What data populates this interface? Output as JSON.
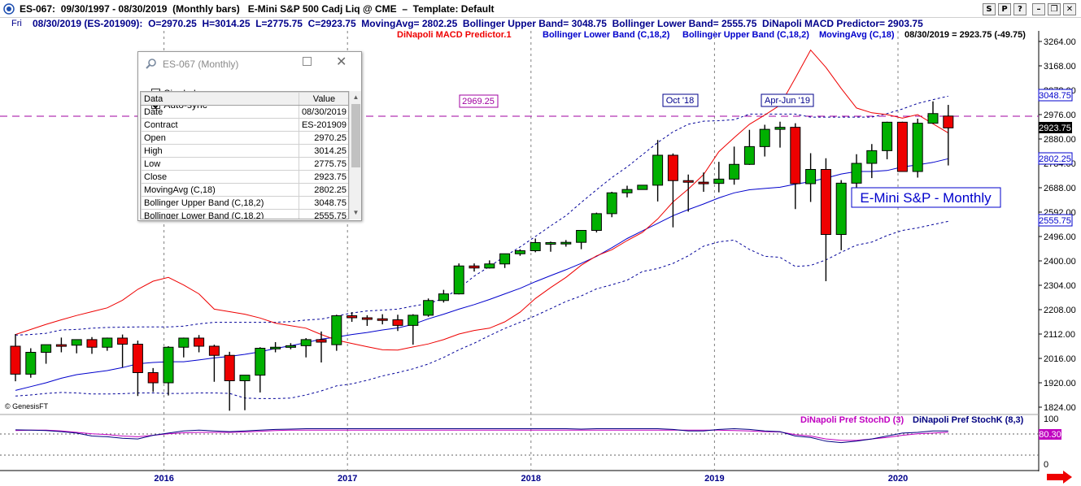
{
  "window": {
    "title": "ES-067:  09/30/1997 - 08/30/2019  (Monthly bars)   E-Mini S&P 500 Cadj Liq @ CME  –  Template: Default",
    "buttons": [
      "S",
      "P",
      "?",
      "–",
      "❐",
      "✕"
    ]
  },
  "infobar": {
    "day": "Fri",
    "data": "08/30/2019 (ES-201909):  O=2970.25  H=3014.25  L=2775.75  C=2923.75  MovingAvg= 2802.25  Bollinger Upper Band= 3048.75  Bollinger Lower Band= 2555.75  DiNapoli MACD Predictor= 2903.75"
  },
  "legend": {
    "macd": "DiNapoli MACD Predictor.1",
    "lower": "Bollinger Lower Band (C,18,2)",
    "upper": "Bollinger Upper Band (C,18,2)",
    "ma": "MovingAvg (C,18)",
    "last": "08/30/2019 = 2923.75 (-49.75)"
  },
  "colors": {
    "up_candle": "#00b000",
    "down_candle": "#ee0000",
    "macd": "#ee0000",
    "ma": "#0000cc",
    "bands": "#000099",
    "stoch_d": "#c000c0",
    "stoch_k": "#000080",
    "hline": "#a000a0"
  },
  "popup": {
    "title": "ES-067 (Monthly)",
    "single_bar": "Single bar",
    "auto_sync": "Auto-sync",
    "header": [
      "Data",
      "Value"
    ],
    "rows": [
      [
        "Date",
        "08/30/2019"
      ],
      [
        "Contract",
        "ES-201909"
      ],
      [
        "Open",
        "2970.25"
      ],
      [
        "High",
        "3014.25"
      ],
      [
        "Low",
        "2775.75"
      ],
      [
        "Close",
        "2923.75"
      ],
      [
        "MovingAvg (C,18)",
        "2802.25"
      ],
      [
        "Bollinger Upper Band (C,18,2)",
        "3048.75"
      ],
      [
        "Bollinger Lower Band (C,18,2)",
        "2555.75"
      ]
    ]
  },
  "annotations": {
    "hline_label": "2969.25",
    "oct18": "Oct '18",
    "aprjun19": "Apr-Jun '19",
    "big_label": "E-Mini S&P - Monthly",
    "watermark": "© GenesisFT"
  },
  "price_badges": {
    "upper": "3048.75",
    "close": "2923.75",
    "ma": "2802.25",
    "lower": "2555.75"
  },
  "stoch": {
    "labels": [
      "DiNapoli Pref StochD (3)",
      "DiNapoli Pref StochK (8,3)"
    ],
    "value_badge": "80.30",
    "ticks": [
      "100",
      "0"
    ]
  },
  "chart_data": {
    "type": "candlestick",
    "title": "E-Mini S&P - Monthly",
    "x_tick_labels": [
      "2016",
      "2017",
      "2018",
      "2019",
      "2020"
    ],
    "y_tick_labels": [
      "3264.00",
      "3168.00",
      "3072.00",
      "2976.00",
      "2880.00",
      "2784.00",
      "2688.00",
      "2592.00",
      "2496.00",
      "2400.00",
      "2304.00",
      "2208.00",
      "2112.00",
      "2016.00",
      "1920.00",
      "1824.00"
    ],
    "ylim": [
      1795,
      3300
    ],
    "grid": false,
    "series": [
      {
        "name": "Candles (O,H,L,C)",
        "start": "2015-03",
        "values": [
          [
            2064,
            2112,
            1926,
            1954
          ],
          [
            1954,
            2056,
            1940,
            2040
          ],
          [
            2040,
            2068,
            1995,
            2070
          ],
          [
            2070,
            2098,
            2040,
            2066
          ],
          [
            2068,
            2084,
            2036,
            2090
          ],
          [
            2090,
            2100,
            2034,
            2060
          ],
          [
            2060,
            2098,
            2046,
            2096
          ],
          [
            2096,
            2110,
            1981,
            2072
          ],
          [
            2072,
            2086,
            1868,
            1960
          ],
          [
            1960,
            1978,
            1884,
            1920
          ],
          [
            1920,
            2064,
            1870,
            2060
          ],
          [
            2060,
            2098,
            2020,
            2096
          ],
          [
            2096,
            2108,
            2040,
            2064
          ],
          [
            2064,
            2070,
            1924,
            2028
          ],
          [
            2028,
            2042,
            1810,
            1928
          ],
          [
            1928,
            1942,
            1812,
            1950
          ],
          [
            1950,
            2060,
            1882,
            2056
          ],
          [
            2056,
            2080,
            2040,
            2060
          ],
          [
            2060,
            2076,
            2052,
            2066
          ],
          [
            2066,
            2096,
            2020,
            2090
          ],
          [
            2090,
            2122,
            2000,
            2080
          ],
          [
            2070,
            2188,
            2046,
            2184
          ],
          [
            2184,
            2198,
            2160,
            2176
          ],
          [
            2176,
            2186,
            2144,
            2172
          ],
          [
            2172,
            2190,
            2150,
            2168
          ],
          [
            2168,
            2188,
            2124,
            2146
          ],
          [
            2146,
            2190,
            2070,
            2186
          ],
          [
            2186,
            2252,
            2180,
            2244
          ],
          [
            2244,
            2286,
            2236,
            2270
          ],
          [
            2270,
            2390,
            2268,
            2380
          ],
          [
            2380,
            2390,
            2358,
            2372
          ],
          [
            2372,
            2402,
            2370,
            2388
          ],
          [
            2388,
            2424,
            2372,
            2428
          ],
          [
            2428,
            2446,
            2420,
            2440
          ],
          [
            2440,
            2488,
            2434,
            2472
          ],
          [
            2472,
            2476,
            2436,
            2472
          ],
          [
            2472,
            2482,
            2456,
            2473
          ],
          [
            2473,
            2518,
            2446,
            2520
          ],
          [
            2520,
            2590,
            2512,
            2586
          ],
          [
            2586,
            2672,
            2572,
            2668
          ],
          [
            2668,
            2696,
            2650,
            2681
          ],
          [
            2681,
            2694,
            2684,
            2698
          ],
          [
            2698,
            2876,
            2634,
            2816
          ],
          [
            2816,
            2823,
            2532,
            2716
          ],
          [
            2716,
            2740,
            2594,
            2710
          ],
          [
            2710,
            2748,
            2672,
            2708
          ],
          [
            2705,
            2790,
            2670,
            2722
          ],
          [
            2722,
            2850,
            2700,
            2780
          ],
          [
            2780,
            2916,
            2778,
            2850
          ],
          [
            2850,
            2936,
            2811,
            2918
          ],
          [
            2918,
            2948,
            2846,
            2926
          ],
          [
            2926,
            2942,
            2604,
            2704
          ],
          [
            2704,
            2824,
            2632,
            2760
          ],
          [
            2760,
            2804,
            2320,
            2504
          ],
          [
            2504,
            2718,
            2442,
            2706
          ],
          [
            2706,
            2820,
            2680,
            2784
          ],
          [
            2784,
            2860,
            2726,
            2834
          ],
          [
            2834,
            2948,
            2800,
            2946
          ],
          [
            2946,
            2948,
            2752,
            2752
          ],
          [
            2752,
            2960,
            2728,
            2942
          ],
          [
            2942,
            3028,
            2940,
            2980
          ],
          [
            2970.25,
            3014.25,
            2775.75,
            2923.75
          ]
        ]
      },
      {
        "name": "MovingAvg (C,18)",
        "start": "2015-03",
        "values": [
          1890,
          1905,
          1920,
          1938,
          1952,
          1960,
          1968,
          1980,
          1995,
          2000,
          2003,
          2003,
          2010,
          2018,
          2024,
          2032,
          2042,
          2055,
          2066,
          2078,
          2092,
          2100,
          2110,
          2118,
          2128,
          2136,
          2150,
          2172,
          2190,
          2210,
          2228,
          2248,
          2270,
          2292,
          2318,
          2342,
          2365,
          2390,
          2418,
          2452,
          2488,
          2518,
          2548,
          2578,
          2602,
          2624,
          2648,
          2668,
          2680,
          2685,
          2690,
          2702,
          2712,
          2726,
          2742,
          2752,
          2752,
          2756,
          2770,
          2778,
          2788,
          2802.25
        ]
      },
      {
        "name": "Bollinger Upper Band (C,18,2)",
        "start": "2015-03",
        "values": [
          2108,
          2110,
          2115,
          2128,
          2130,
          2135,
          2138,
          2139,
          2140,
          2140,
          2140,
          2143,
          2152,
          2158,
          2158,
          2158,
          2158,
          2158,
          2161,
          2167,
          2171,
          2183,
          2195,
          2203,
          2206,
          2210,
          2222,
          2232,
          2252,
          2292,
          2340,
          2378,
          2418,
          2455,
          2496,
          2538,
          2578,
          2630,
          2680,
          2728,
          2770,
          2818,
          2866,
          2908,
          2938,
          2950,
          2952,
          2956,
          2978,
          2978,
          2978,
          2978,
          2966,
          2966,
          2966,
          2966,
          2966,
          2980,
          2998,
          3020,
          3035,
          3048.75
        ]
      },
      {
        "name": "Bollinger Lower Band (C,18,2)",
        "start": "2015-03",
        "values": [
          1868,
          1872,
          1878,
          1882,
          1880,
          1876,
          1876,
          1877,
          1880,
          1880,
          1878,
          1878,
          1880,
          1880,
          1878,
          1860,
          1858,
          1858,
          1860,
          1872,
          1888,
          1908,
          1916,
          1930,
          1947,
          1960,
          1975,
          1994,
          2020,
          2050,
          2076,
          2106,
          2134,
          2158,
          2184,
          2212,
          2240,
          2262,
          2290,
          2306,
          2324,
          2358,
          2370,
          2390,
          2420,
          2458,
          2475,
          2482,
          2445,
          2418,
          2414,
          2378,
          2382,
          2404,
          2434,
          2462,
          2474,
          2500,
          2520,
          2530,
          2543,
          2555.75
        ]
      },
      {
        "name": "DiNapoli MACD Predictor.1",
        "start": "2015-03",
        "values": [
          2110,
          2130,
          2150,
          2168,
          2185,
          2200,
          2215,
          2245,
          2288,
          2320,
          2335,
          2305,
          2270,
          2210,
          2200,
          2190,
          2175,
          2155,
          2145,
          2135,
          2110,
          2088,
          2075,
          2062,
          2050,
          2049,
          2061,
          2073,
          2090,
          2112,
          2126,
          2135,
          2160,
          2198,
          2252,
          2295,
          2335,
          2383,
          2420,
          2444,
          2480,
          2512,
          2565,
          2632,
          2683,
          2740,
          2830,
          2885,
          2938,
          2974,
          3013,
          3120,
          3230,
          3162,
          3079,
          3002,
          2983,
          2976,
          2962,
          2976,
          2940,
          2903.75
        ]
      }
    ],
    "stoch_series": [
      {
        "name": "DiNapoli Pref StochD (3)",
        "values": [
          85,
          86,
          86,
          84,
          80,
          76,
          74,
          70,
          68,
          72,
          76,
          79,
          80,
          80,
          80,
          81,
          83,
          85,
          86,
          86,
          86,
          86,
          86,
          86,
          86,
          86,
          86,
          86,
          86,
          86,
          86,
          86,
          86,
          86,
          86,
          86,
          86,
          86,
          86,
          86,
          86,
          86,
          86,
          86,
          86,
          86,
          86,
          85,
          84,
          82,
          81,
          74,
          70,
          62,
          58,
          58,
          62,
          66,
          72,
          76,
          78,
          80.3
        ]
      },
      {
        "name": "DiNapoli Pref StochK (8,3)",
        "values": [
          87,
          86,
          85,
          82,
          78,
          70,
          68,
          64,
          62,
          72,
          78,
          84,
          86,
          84,
          82,
          84,
          86,
          88,
          89,
          90,
          90,
          90,
          90,
          90,
          90,
          90,
          90,
          90,
          90,
          90,
          90,
          90,
          90,
          90,
          90,
          90,
          90,
          89,
          90,
          90,
          90,
          90,
          90,
          88,
          84,
          84,
          88,
          90,
          88,
          84,
          82,
          70,
          66,
          56,
          52,
          56,
          62,
          70,
          78,
          80,
          84,
          84
        ]
      }
    ]
  }
}
